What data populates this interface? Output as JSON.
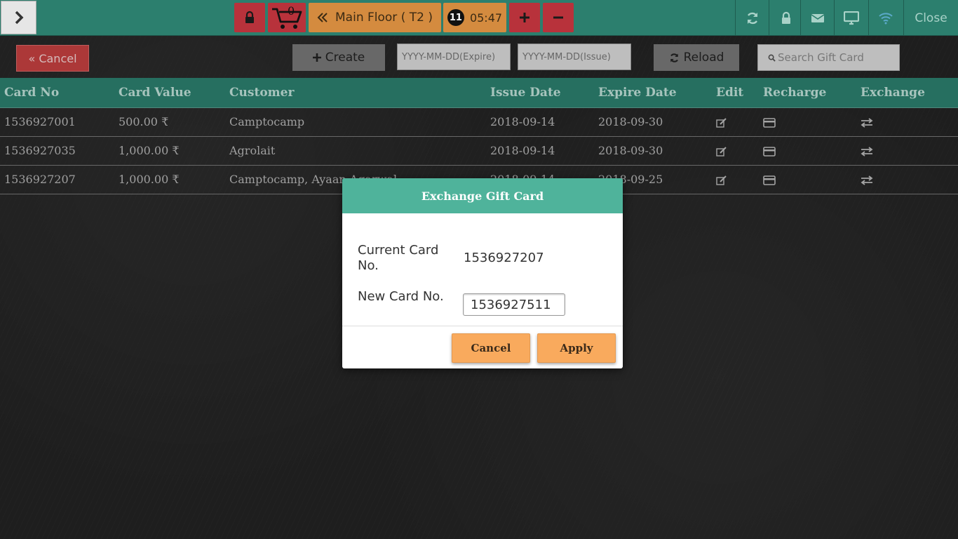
{
  "topbar": {
    "cart_count": "0",
    "floor_label": "Main Floor ( T2 )",
    "clock_badge": "11",
    "clock_time": "05:47",
    "close_label": "Close"
  },
  "toolbar": {
    "cancel_label": "« Cancel",
    "create_label": "Create",
    "expire_placeholder": "YYYY-MM-DD(Expire)",
    "issue_placeholder": "YYYY-MM-DD(Issue)",
    "reload_label": "Reload",
    "search_placeholder": "Search Gift Card"
  },
  "table": {
    "headers": {
      "card_no": "Card No",
      "card_value": "Card Value",
      "customer": "Customer",
      "issue_date": "Issue Date",
      "expire_date": "Expire Date",
      "edit": "Edit",
      "recharge": "Recharge",
      "exchange": "Exchange"
    },
    "rows": [
      {
        "card_no": "1536927001",
        "card_value": "500.00 ₹",
        "customer": "Camptocamp",
        "issue_date": "2018-09-14",
        "expire_date": "2018-09-30"
      },
      {
        "card_no": "1536927035",
        "card_value": "1,000.00 ₹",
        "customer": "Agrolait",
        "issue_date": "2018-09-14",
        "expire_date": "2018-09-30"
      },
      {
        "card_no": "1536927207",
        "card_value": "1,000.00 ₹",
        "customer": "Camptocamp, Ayaan Agarwal",
        "issue_date": "2018-09-14",
        "expire_date": "2018-09-25"
      }
    ]
  },
  "modal": {
    "title": "Exchange Gift Card",
    "current_label": "Current Card No.",
    "current_value": "1536927207",
    "new_label": "New Card No.",
    "new_value": "1536927511",
    "cancel_label": "Cancel",
    "apply_label": "Apply"
  },
  "colors": {
    "topbar": "#2c7f6e",
    "modal_header": "#4fb39b",
    "button_orange": "#f9aa5d",
    "button_red": "#b8323b"
  }
}
